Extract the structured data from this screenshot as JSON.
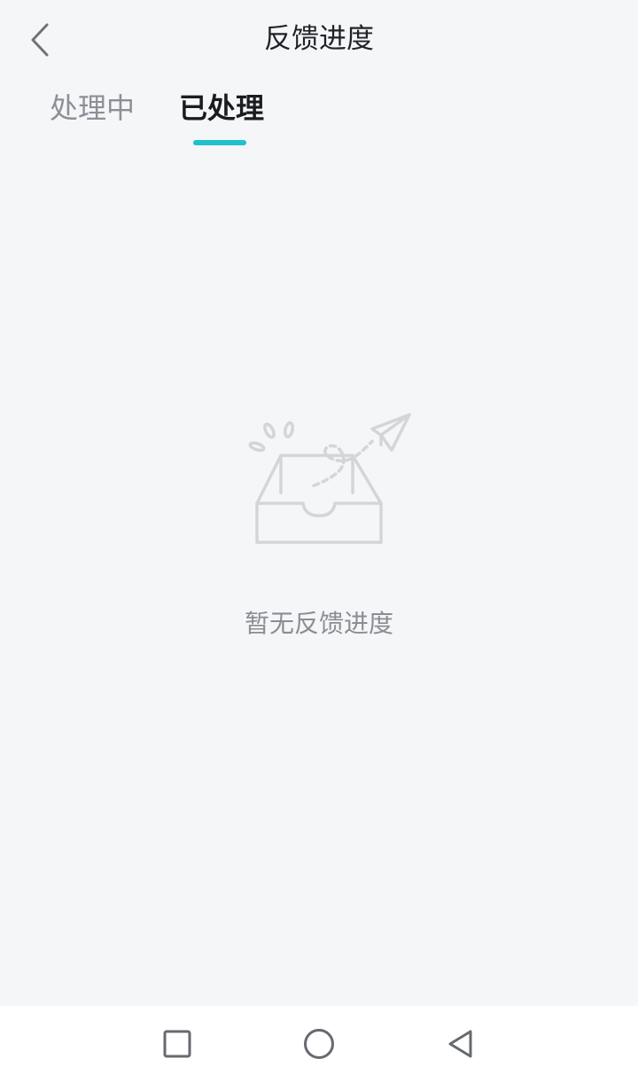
{
  "header": {
    "title": "反馈进度",
    "back_icon": "chevron-left-icon"
  },
  "tabs": [
    {
      "label": "处理中",
      "active": false
    },
    {
      "label": "已处理",
      "active": true
    }
  ],
  "colors": {
    "accent": "#20c0cc",
    "background": "#f4f6f8",
    "title_text": "#1f2227",
    "inactive_tab": "#8c9096",
    "empty_text": "#8a8e94",
    "illustration": "#d3d6d9"
  },
  "empty_state": {
    "icon": "empty-inbox-paper-plane-icon",
    "message": "暂无反馈进度"
  },
  "system_nav": {
    "recent_icon": "square-icon",
    "home_icon": "circle-icon",
    "back_icon": "triangle-back-icon"
  }
}
